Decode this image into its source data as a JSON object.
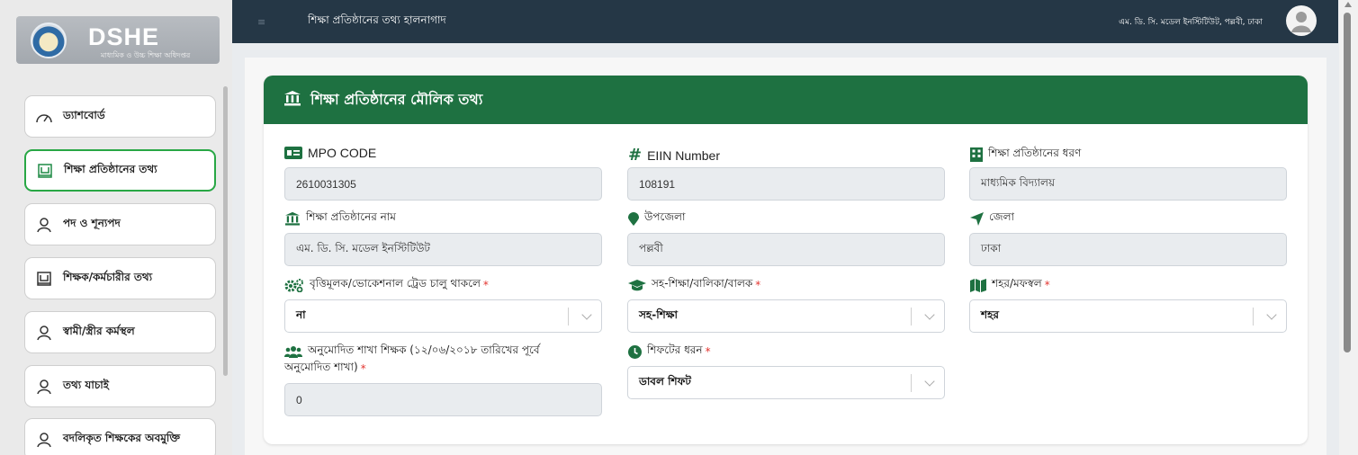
{
  "brand": {
    "title": "DSHE",
    "subtitle": "মাধ্যমিক ও উচ্চ শিক্ষা অধিদপ্তর"
  },
  "topbar": {
    "page_title": "শিক্ষা প্রতিষ্ঠানের তথ্য হালনাগাদ",
    "institution": "এম. ডি. সি. মডেল ইনস্টিটিউট, পল্লবী, ঢাকা"
  },
  "sidebar": {
    "items": [
      {
        "label": "ড্যাশবোর্ড",
        "icon": "dashboard-gauge-icon"
      },
      {
        "label": "শিক্ষা প্রতিষ্ঠানের তথ্য",
        "icon": "building-icon",
        "active": true
      },
      {
        "label": "পদ ও শূন্যপদ",
        "icon": "user-outline-icon"
      },
      {
        "label": "শিক্ষক/কর্মচারীর তথ্য",
        "icon": "building-icon"
      },
      {
        "label": "স্বামী/স্ত্রীর কর্মস্থল",
        "icon": "user-outline-icon"
      },
      {
        "label": "তথ্য যাচাই",
        "icon": "user-outline-icon"
      },
      {
        "label": "বদলিকৃত শিক্ষকের অবমুক্তি",
        "icon": "user-outline-icon"
      }
    ]
  },
  "card": {
    "title": "শিক্ষা প্রতিষ্ঠানের মৌলিক তথ্য",
    "fields": {
      "mpo_code": {
        "label": "MPO CODE",
        "value": "2610031305"
      },
      "eiin": {
        "label": "EIIN Number",
        "value": "108191"
      },
      "inst_type": {
        "label": "শিক্ষা প্রতিষ্ঠানের ধরণ",
        "value": "মাধ্যমিক বিদ্যালয়"
      },
      "inst_name": {
        "label": "শিক্ষা প্রতিষ্ঠানের নাম",
        "value": "এম. ডি. সি. মডেল ইনস্টিটিউট"
      },
      "upazila": {
        "label": "উপজেলা",
        "value": "পল্লবী"
      },
      "district": {
        "label": "জেলা",
        "value": "ঢাকা"
      },
      "vocational": {
        "label": "বৃত্তিমূলক/ভোকেশনাল ট্রেড চালু থাকলে",
        "value": "না",
        "required": "*"
      },
      "coed": {
        "label": "সহ-শিক্ষা/বালিকা/বালক",
        "value": "সহ-শিক্ষা",
        "required": "*"
      },
      "area": {
        "label": "শহর/মফস্বল",
        "value": "শহর",
        "required": "*"
      },
      "approved_teacher_line1": "অনুমোদিত শাখা শিক্ষক (১২/০৬/২০১৮ তারিখের পূর্বে",
      "approved_teacher_line2": "অনুমোদিত শাখা)",
      "approved_teacher_required": "*",
      "approved_teacher_value": "0",
      "shift": {
        "label": "শিফটের ধরন",
        "value": "ডাবল শিফট",
        "required": "*"
      }
    }
  },
  "colors": {
    "topbar": "#253746",
    "card_header": "#1e7141",
    "active_border": "#28a745",
    "icon_green": "#1e7141"
  }
}
